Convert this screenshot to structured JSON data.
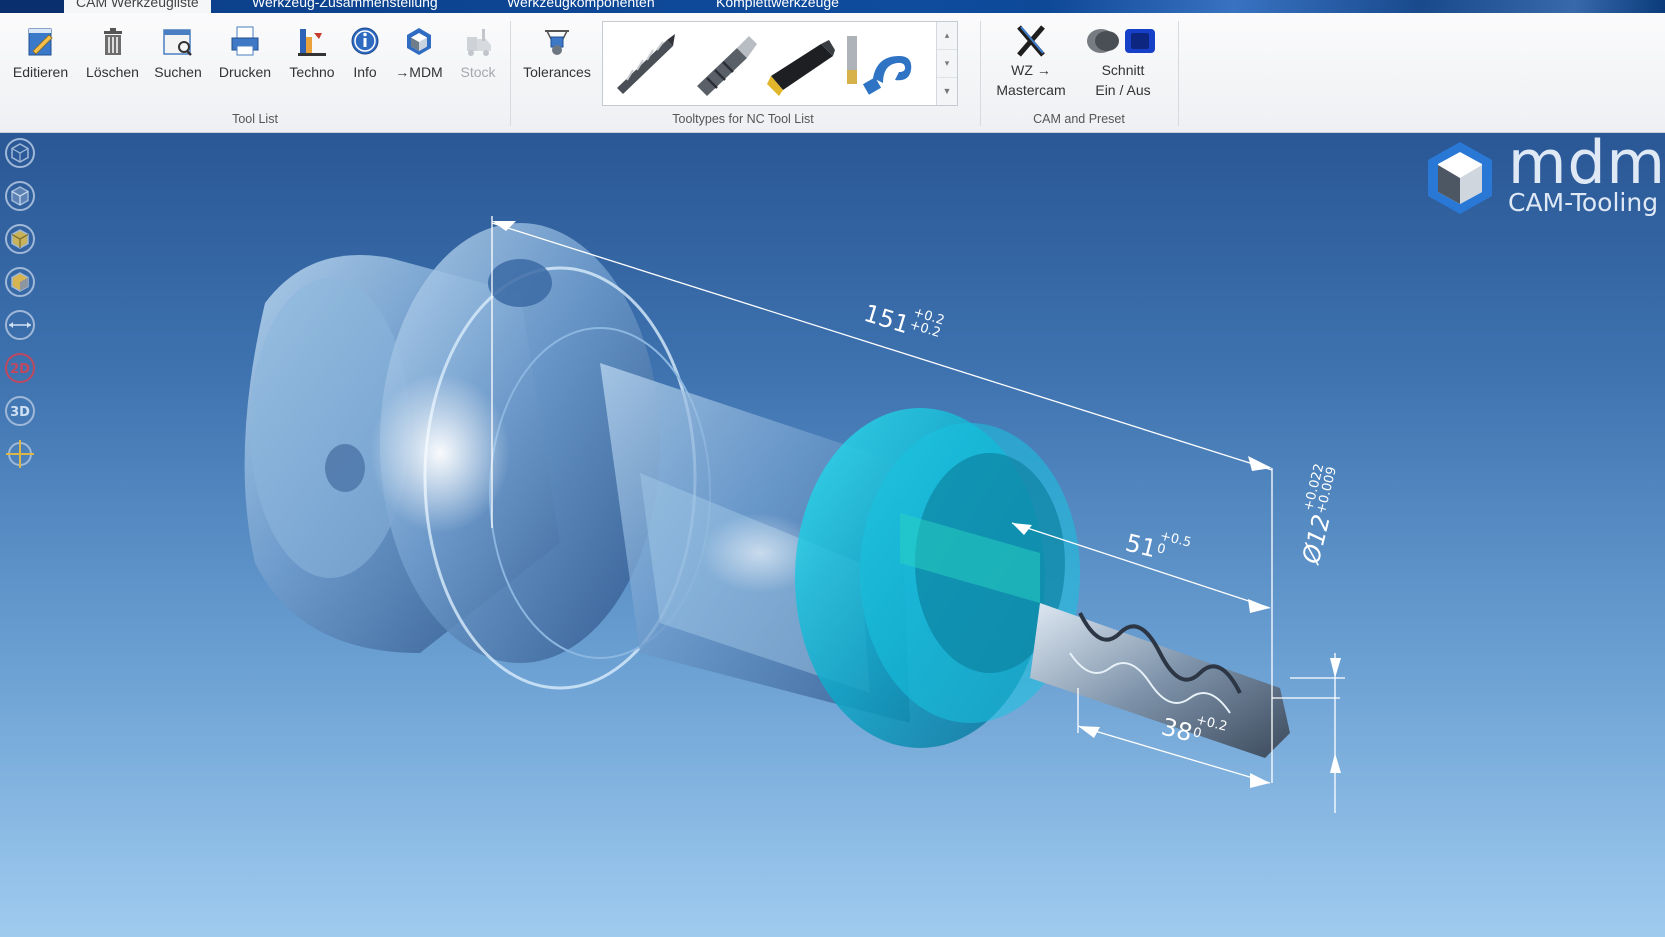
{
  "tabs": [
    {
      "label": "CAM Werkzeugliste",
      "active": true
    },
    {
      "label": "Werkzeug-Zusammenstellung",
      "active": false
    },
    {
      "label": "Werkzeugkomponenten",
      "active": false
    },
    {
      "label": "Komplettwerkzeuge",
      "active": false
    }
  ],
  "ribbon": {
    "tool_list": {
      "label": "Tool List",
      "buttons": [
        {
          "label": "Editieren",
          "icon": "edit-icon"
        },
        {
          "label": "Löschen",
          "icon": "trash-icon"
        },
        {
          "label": "Suchen",
          "icon": "search-folder-icon"
        },
        {
          "label": "Drucken",
          "icon": "print-icon"
        },
        {
          "label": "Techno",
          "icon": "techno-icon"
        },
        {
          "label": "Info",
          "icon": "info-icon"
        },
        {
          "label": "→MDM",
          "icon": "mdm-cube-icon"
        },
        {
          "label": "Stock",
          "icon": "stock-icon",
          "disabled": true
        }
      ]
    },
    "tooltypes": {
      "label": "Tooltypes for NC Tool List",
      "tolerances_label": "Tolerances",
      "gallery_items": [
        "drill-icon",
        "end-mill-icon",
        "turning-holder-icon",
        "reamer-hook-icon"
      ]
    },
    "cam_preset": {
      "label": "CAM and Preset",
      "wz_label_1": "WZ →",
      "wz_label_2": "Mastercam",
      "schnitt_label_1": "Schnitt",
      "schnitt_label_2": "Ein / Aus"
    }
  },
  "viewport": {
    "view_buttons": [
      "view-iso-1-icon",
      "view-iso-2-icon",
      "view-iso-3-icon",
      "view-iso-4-icon",
      "measure-icon",
      "2d-icon",
      "3d-icon",
      "center-icon"
    ],
    "view_2d": "2D",
    "view_3d": "3D",
    "logo_word": "mdm",
    "logo_sub": "CAM-Tooling",
    "dimensions": {
      "length_total": {
        "value": "151",
        "tol_upper": "+0.2",
        "tol_lower": "+0.2"
      },
      "length_51": {
        "value": "51",
        "tol_upper": "+0.5",
        "tol_lower": "0"
      },
      "length_38": {
        "value": "38",
        "tol_upper": "+0.2",
        "tol_lower": "0"
      },
      "diameter": {
        "value": "Ø12",
        "tol_upper": "+0.022",
        "tol_lower": "+0.009"
      }
    },
    "colors": {
      "accent_cyan": "#19c6e6",
      "steel": "#8fb3d6"
    }
  }
}
